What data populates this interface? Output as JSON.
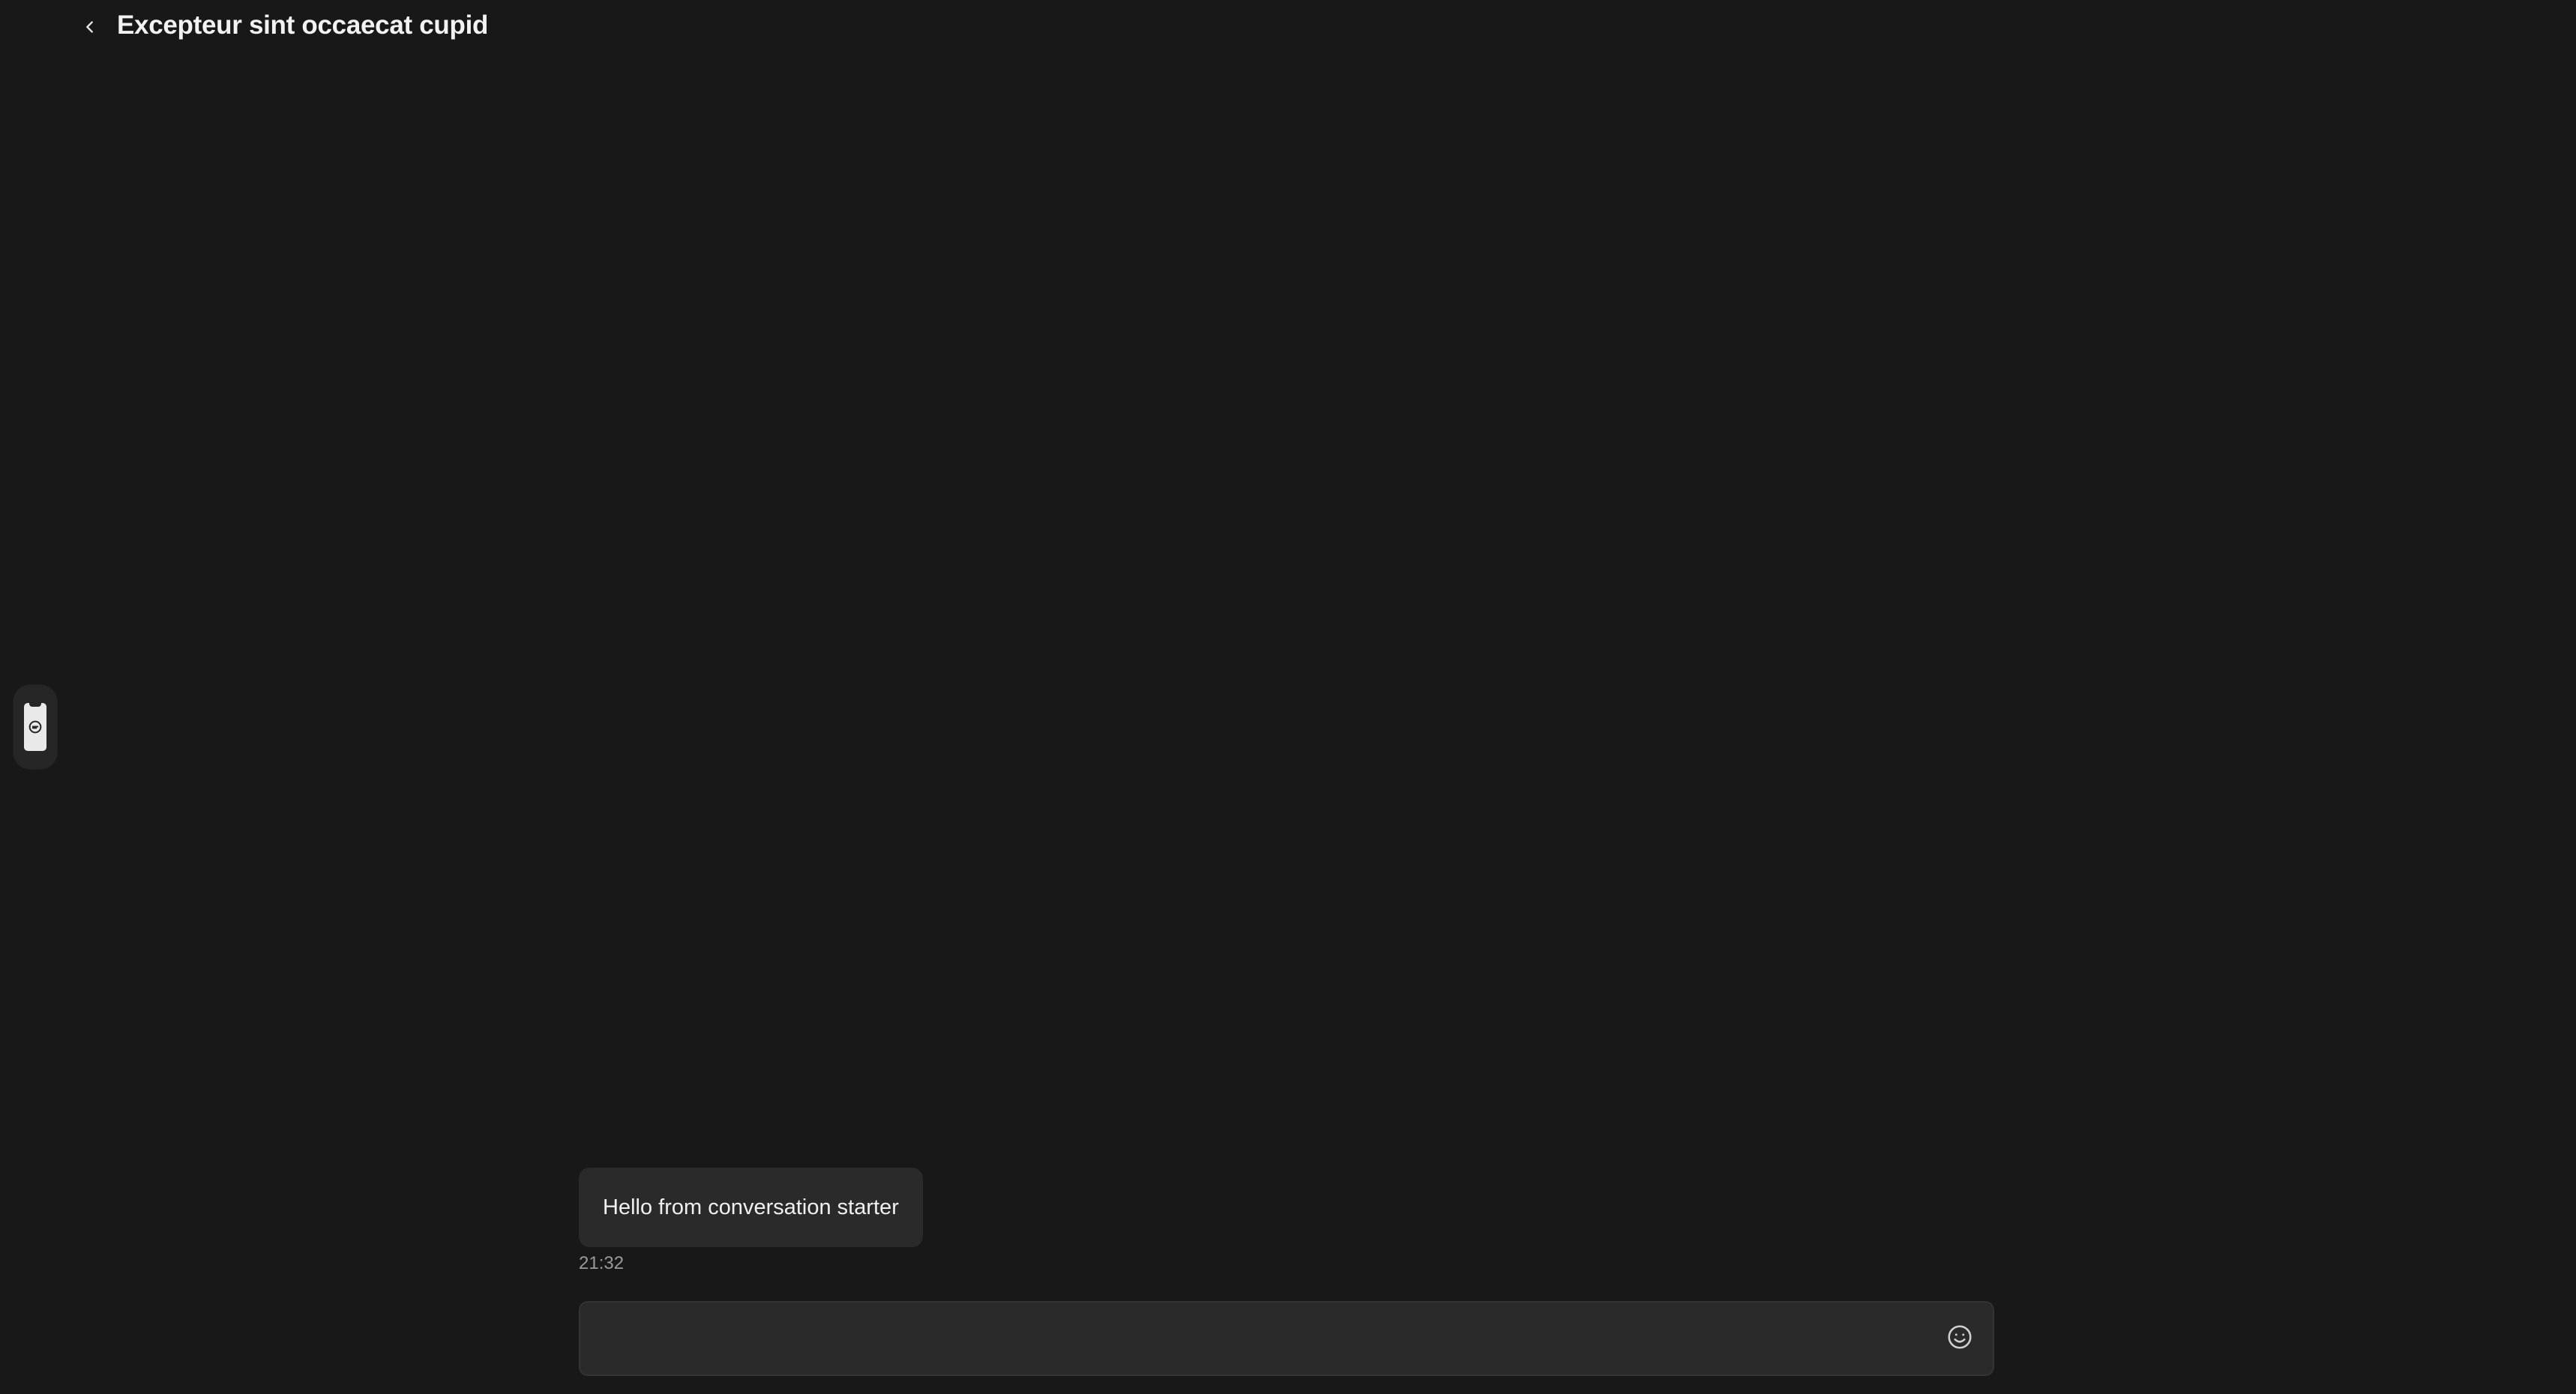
{
  "header": {
    "title": "Excepteur sint occaecat cupid",
    "back_icon": "chevron-left-icon"
  },
  "side_handle": {
    "icon": "phone-chat-icon"
  },
  "conversation": {
    "messages": [
      {
        "text": "Hello from conversation starter",
        "time": "21:32"
      }
    ]
  },
  "composer": {
    "value": "",
    "placeholder": "",
    "emoji_icon": "smiley-icon"
  },
  "colors": {
    "background": "#181818",
    "bubble": "#2a2a2a",
    "composer": "#2a2a2a",
    "text": "#f0f0f0",
    "muted": "#9a9a9a"
  }
}
